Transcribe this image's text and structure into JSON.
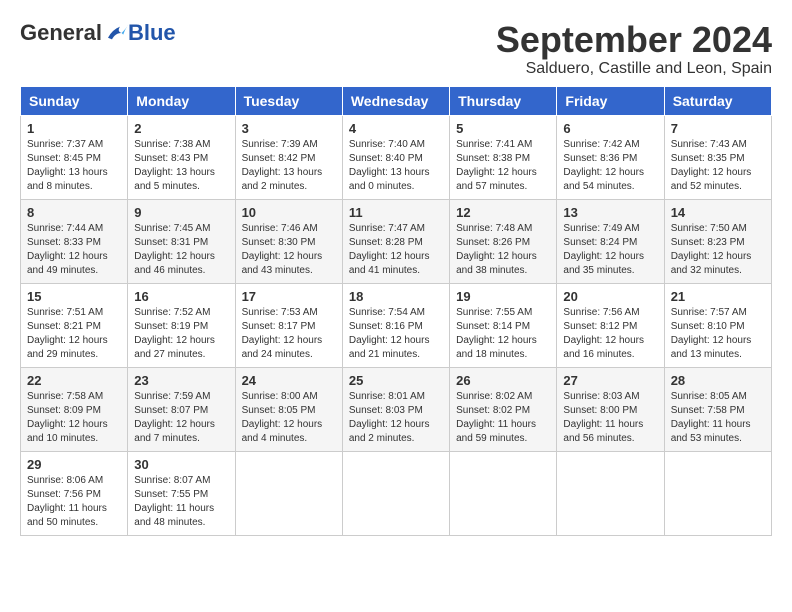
{
  "header": {
    "logo_general": "General",
    "logo_blue": "Blue",
    "month_title": "September 2024",
    "location": "Salduero, Castille and Leon, Spain"
  },
  "weekdays": [
    "Sunday",
    "Monday",
    "Tuesday",
    "Wednesday",
    "Thursday",
    "Friday",
    "Saturday"
  ],
  "weeks": [
    [
      {
        "day": "1",
        "sunrise": "7:37 AM",
        "sunset": "8:45 PM",
        "daylight": "13 hours and 8 minutes."
      },
      {
        "day": "2",
        "sunrise": "7:38 AM",
        "sunset": "8:43 PM",
        "daylight": "13 hours and 5 minutes."
      },
      {
        "day": "3",
        "sunrise": "7:39 AM",
        "sunset": "8:42 PM",
        "daylight": "13 hours and 2 minutes."
      },
      {
        "day": "4",
        "sunrise": "7:40 AM",
        "sunset": "8:40 PM",
        "daylight": "13 hours and 0 minutes."
      },
      {
        "day": "5",
        "sunrise": "7:41 AM",
        "sunset": "8:38 PM",
        "daylight": "12 hours and 57 minutes."
      },
      {
        "day": "6",
        "sunrise": "7:42 AM",
        "sunset": "8:36 PM",
        "daylight": "12 hours and 54 minutes."
      },
      {
        "day": "7",
        "sunrise": "7:43 AM",
        "sunset": "8:35 PM",
        "daylight": "12 hours and 52 minutes."
      }
    ],
    [
      {
        "day": "8",
        "sunrise": "7:44 AM",
        "sunset": "8:33 PM",
        "daylight": "12 hours and 49 minutes."
      },
      {
        "day": "9",
        "sunrise": "7:45 AM",
        "sunset": "8:31 PM",
        "daylight": "12 hours and 46 minutes."
      },
      {
        "day": "10",
        "sunrise": "7:46 AM",
        "sunset": "8:30 PM",
        "daylight": "12 hours and 43 minutes."
      },
      {
        "day": "11",
        "sunrise": "7:47 AM",
        "sunset": "8:28 PM",
        "daylight": "12 hours and 41 minutes."
      },
      {
        "day": "12",
        "sunrise": "7:48 AM",
        "sunset": "8:26 PM",
        "daylight": "12 hours and 38 minutes."
      },
      {
        "day": "13",
        "sunrise": "7:49 AM",
        "sunset": "8:24 PM",
        "daylight": "12 hours and 35 minutes."
      },
      {
        "day": "14",
        "sunrise": "7:50 AM",
        "sunset": "8:23 PM",
        "daylight": "12 hours and 32 minutes."
      }
    ],
    [
      {
        "day": "15",
        "sunrise": "7:51 AM",
        "sunset": "8:21 PM",
        "daylight": "12 hours and 29 minutes."
      },
      {
        "day": "16",
        "sunrise": "7:52 AM",
        "sunset": "8:19 PM",
        "daylight": "12 hours and 27 minutes."
      },
      {
        "day": "17",
        "sunrise": "7:53 AM",
        "sunset": "8:17 PM",
        "daylight": "12 hours and 24 minutes."
      },
      {
        "day": "18",
        "sunrise": "7:54 AM",
        "sunset": "8:16 PM",
        "daylight": "12 hours and 21 minutes."
      },
      {
        "day": "19",
        "sunrise": "7:55 AM",
        "sunset": "8:14 PM",
        "daylight": "12 hours and 18 minutes."
      },
      {
        "day": "20",
        "sunrise": "7:56 AM",
        "sunset": "8:12 PM",
        "daylight": "12 hours and 16 minutes."
      },
      {
        "day": "21",
        "sunrise": "7:57 AM",
        "sunset": "8:10 PM",
        "daylight": "12 hours and 13 minutes."
      }
    ],
    [
      {
        "day": "22",
        "sunrise": "7:58 AM",
        "sunset": "8:09 PM",
        "daylight": "12 hours and 10 minutes."
      },
      {
        "day": "23",
        "sunrise": "7:59 AM",
        "sunset": "8:07 PM",
        "daylight": "12 hours and 7 minutes."
      },
      {
        "day": "24",
        "sunrise": "8:00 AM",
        "sunset": "8:05 PM",
        "daylight": "12 hours and 4 minutes."
      },
      {
        "day": "25",
        "sunrise": "8:01 AM",
        "sunset": "8:03 PM",
        "daylight": "12 hours and 2 minutes."
      },
      {
        "day": "26",
        "sunrise": "8:02 AM",
        "sunset": "8:02 PM",
        "daylight": "11 hours and 59 minutes."
      },
      {
        "day": "27",
        "sunrise": "8:03 AM",
        "sunset": "8:00 PM",
        "daylight": "11 hours and 56 minutes."
      },
      {
        "day": "28",
        "sunrise": "8:05 AM",
        "sunset": "7:58 PM",
        "daylight": "11 hours and 53 minutes."
      }
    ],
    [
      {
        "day": "29",
        "sunrise": "8:06 AM",
        "sunset": "7:56 PM",
        "daylight": "11 hours and 50 minutes."
      },
      {
        "day": "30",
        "sunrise": "8:07 AM",
        "sunset": "7:55 PM",
        "daylight": "11 hours and 48 minutes."
      },
      null,
      null,
      null,
      null,
      null
    ]
  ]
}
